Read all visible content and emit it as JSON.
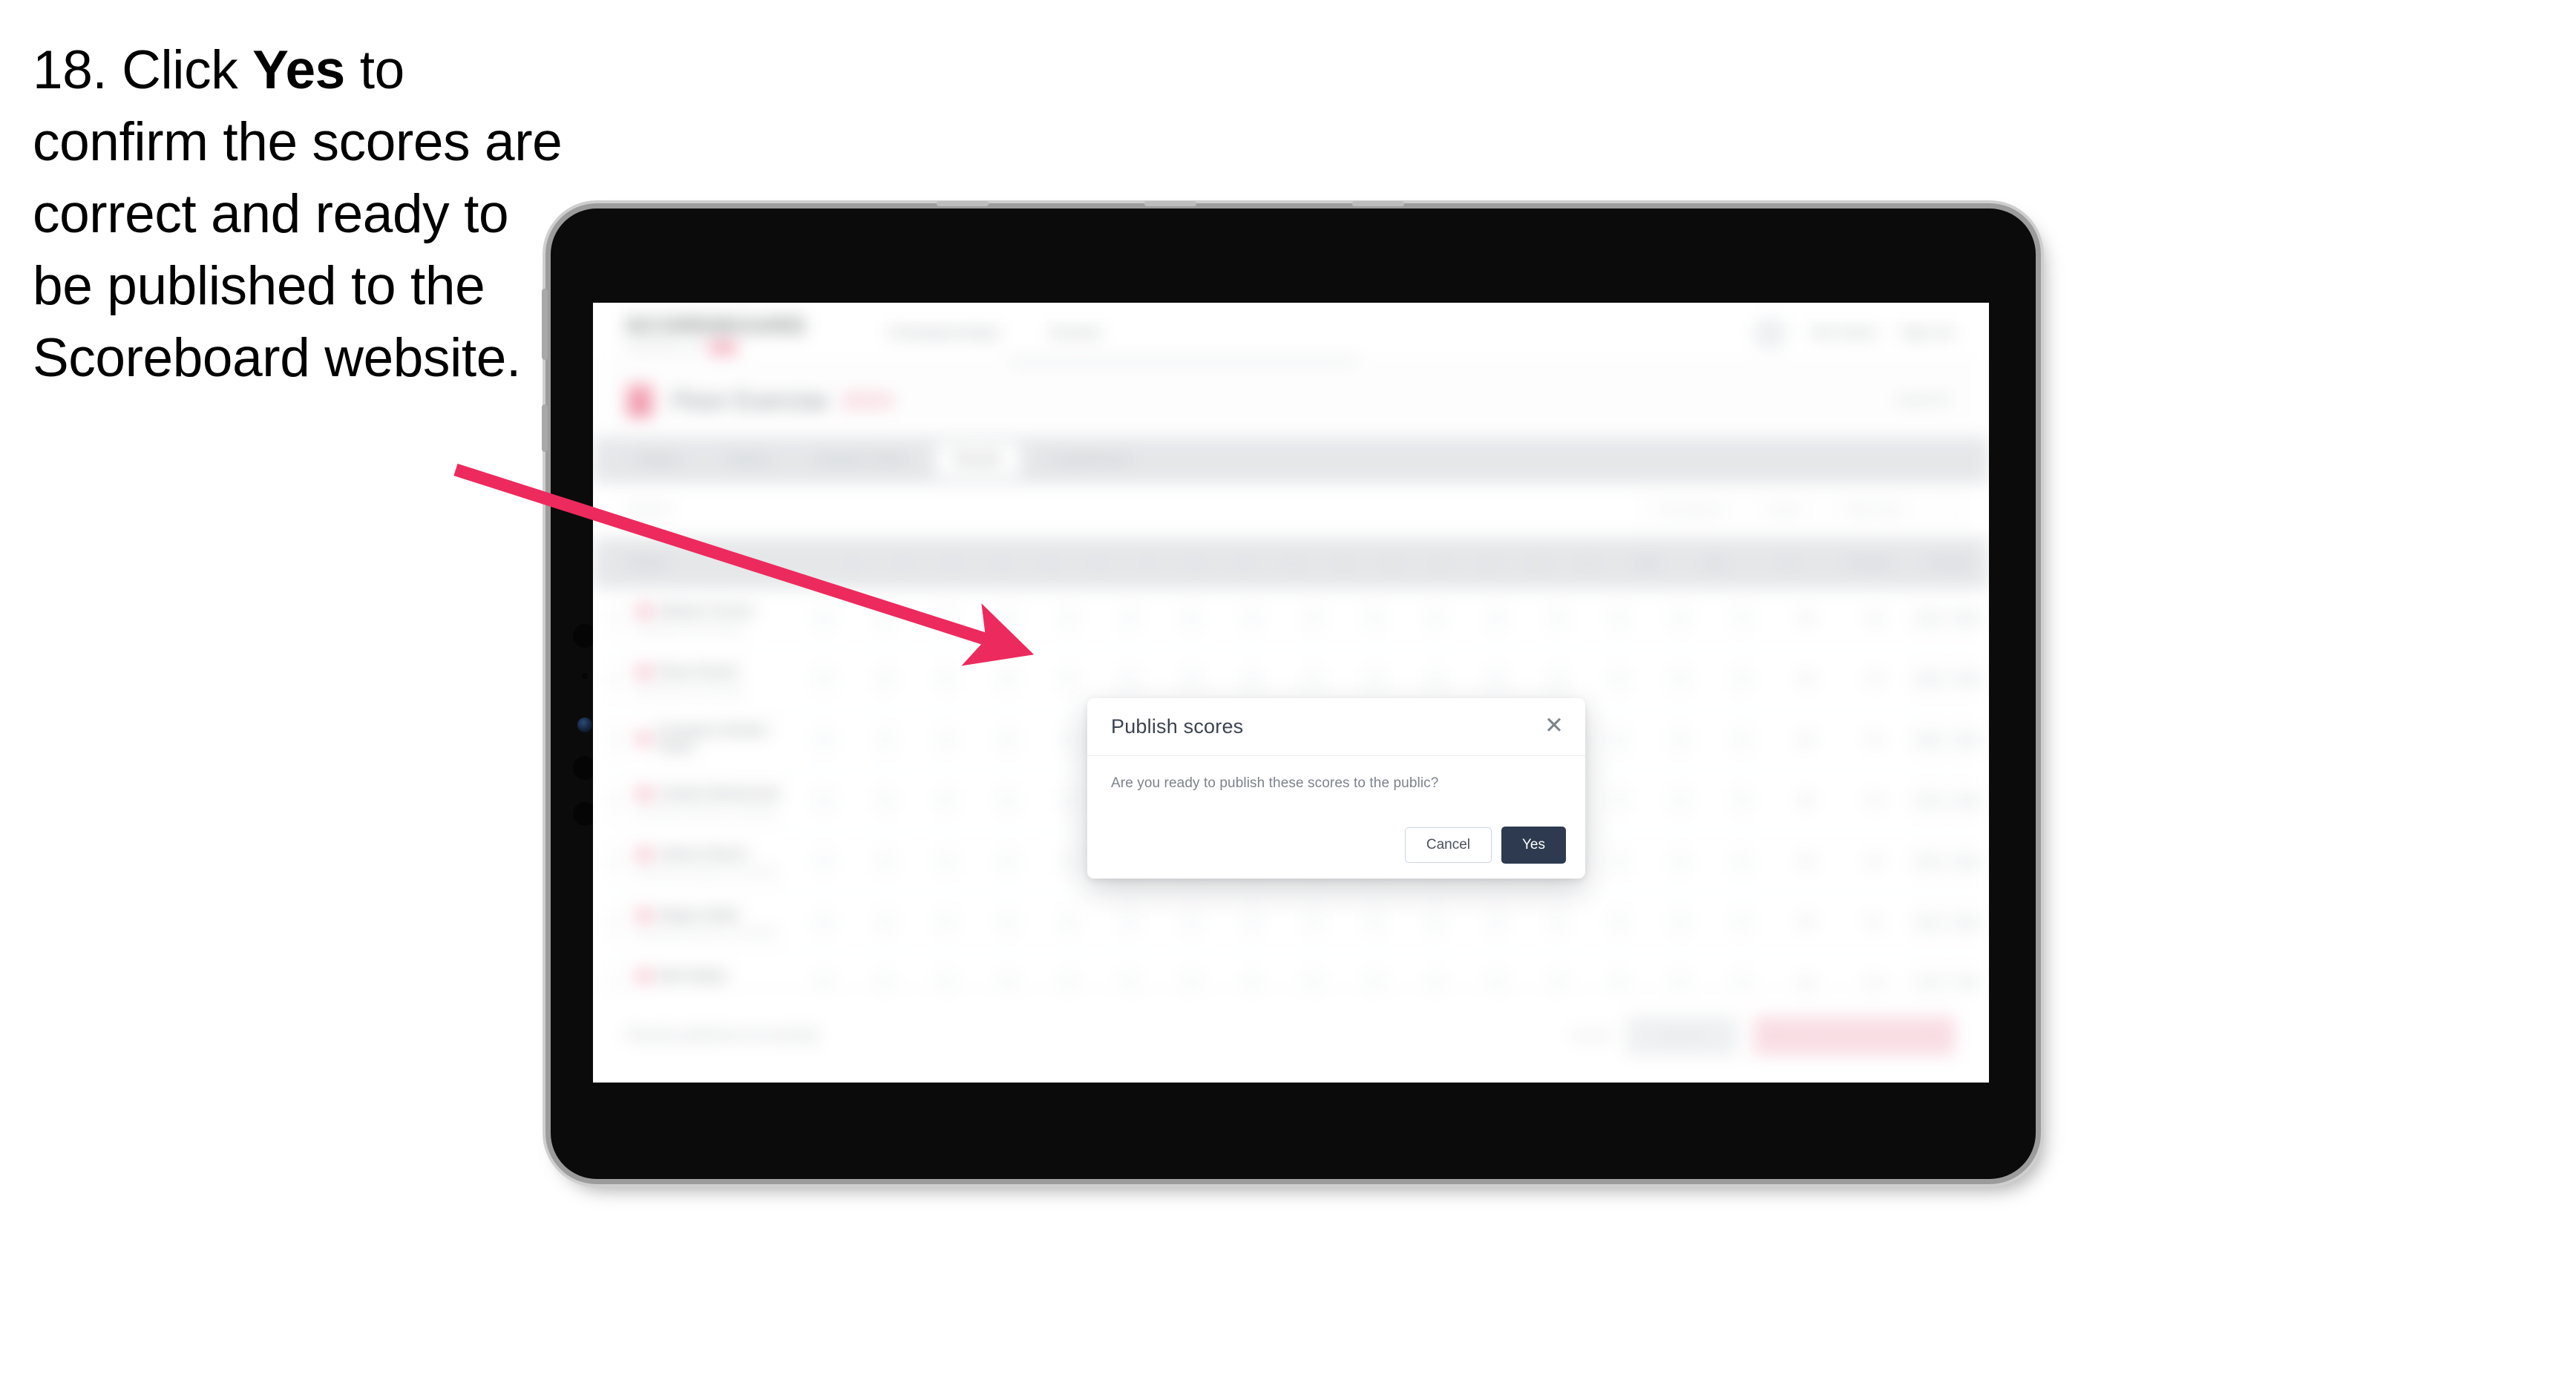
{
  "caption": {
    "prefix": "18. Click ",
    "bold": "Yes",
    "suffix": " to confirm the scores are correct and ready to be published to the Scoreboard website."
  },
  "app": {
    "brand": {
      "name": "SCOREBOARD",
      "subtitle": "POWERED BY",
      "badge": "live"
    },
    "topnav": [
      {
        "label": "Championships"
      },
      {
        "label": "Events"
      }
    ],
    "topnav_right": {
      "user": "Tom Davis",
      "signout": "Sign out",
      "avatar_icon": "avatar-icon"
    },
    "competition": {
      "title": "Floor Exercise",
      "year": "2024",
      "status": "Level 10"
    },
    "tabs": [
      {
        "label": "Judges",
        "active": false
      },
      {
        "label": "Teams",
        "active": false
      },
      {
        "label": "Session Order",
        "active": false
      },
      {
        "label": "Results",
        "active": true
      },
      {
        "label": "Leaderboard",
        "active": false
      }
    ],
    "filters": {
      "left_label": "Search",
      "chips": [
        {
          "label": "All Sessions"
        },
        {
          "label": "Senior"
        },
        {
          "label": "Rank Only"
        },
        {
          "label": "⋮"
        }
      ]
    },
    "table": {
      "headers": {
        "player": "Player",
        "numbered": [
          "1",
          "2",
          "3",
          "4",
          "5",
          "6",
          "7",
          "8",
          "9",
          "10",
          "11",
          "12",
          "13",
          "14",
          "15",
          "16"
        ],
        "wide": [
          "Total",
          "Avg"
        ],
        "right": [
          "D",
          "Penalty",
          "Position"
        ]
      },
      "rows": [
        {
          "name": "Melanie Torrens",
          "sub": "Gymnastic Club Chicago",
          "flag_icon": "flag-icon",
          "cells": [
            "9",
            "9",
            "9",
            "9",
            "9",
            "9",
            "9",
            "9",
            "9",
            "9",
            "9",
            "9",
            "9",
            "9",
            "9",
            "9"
          ],
          "total": "88",
          "avg": "9.6",
          "rank": [
            "1ST",
            "90%"
          ]
        },
        {
          "name": "Rhea Parnell",
          "sub": "Gymnastic Club Chicago",
          "flag_icon": "flag-icon",
          "cells": [
            "9",
            "9",
            "9",
            "9",
            "9",
            "9",
            "9",
            "9",
            "9",
            "9",
            "9",
            "9",
            "9",
            "9",
            "9",
            "9"
          ],
          "total": "88",
          "avg": "9.5",
          "rank": [
            "2ND",
            "88%"
          ]
        },
        {
          "name": "Constance Booker-Hayes",
          "sub": "",
          "flag_icon": "flag-icon",
          "cells": [
            "9",
            "9",
            "9",
            "9",
            "9",
            "9",
            "9",
            "9",
            "9",
            "9",
            "9",
            "9",
            "9",
            "9",
            "9",
            "9"
          ],
          "total": "88",
          "avg": "9.4",
          "rank": [
            "3RD",
            "86%"
          ]
        },
        {
          "name": "Celeste Mohammed",
          "sub": "Gymnastic Academy of Charlotte",
          "flag_icon": "flag-icon",
          "cells": [
            "9",
            "9",
            "9",
            "9",
            "9",
            "9",
            "9",
            "9",
            "9",
            "9",
            "9",
            "9",
            "9",
            "9",
            "9",
            "9"
          ],
          "total": "88",
          "avg": "9.3",
          "rank": [
            "4TH",
            "84%"
          ]
        },
        {
          "name": "Helena Okechi",
          "sub": "Gymnastic Academy of Charlotte",
          "flag_icon": "flag-icon",
          "cells": [
            "9",
            "9",
            "9",
            "9",
            "9",
            "9",
            "9",
            "9",
            "9",
            "9",
            "9",
            "9",
            "9",
            "9",
            "9",
            "9"
          ],
          "total": "88",
          "avg": "9.2",
          "rank": [
            "5TH",
            "82%"
          ]
        },
        {
          "name": "Megan Webb",
          "sub": "Gymnastic Academy of Charlotte",
          "flag_icon": "flag-icon",
          "cells": [
            "9",
            "9",
            "9",
            "9",
            "9",
            "9",
            "9",
            "9",
            "9",
            "9",
            "9",
            "9",
            "9",
            "9",
            "9",
            "9"
          ],
          "total": "88",
          "avg": "9.1",
          "rank": [
            "6TH",
            "80%"
          ]
        },
        {
          "name": "Beth Bailey",
          "sub": "Gymnastic Academy of Charlotte",
          "flag_icon": "flag-icon",
          "cells": [
            "9",
            "9",
            "9",
            "9",
            "9",
            "9",
            "9",
            "9",
            "9",
            "9",
            "9",
            "9",
            "9",
            "9",
            "9",
            "9"
          ],
          "total": "88",
          "avg": "9.0",
          "rank": [
            "7TH",
            "78%"
          ]
        }
      ]
    },
    "footer": {
      "note": "Results published successfully",
      "link": "Cancel",
      "secondary": "Save All",
      "primary": "Publish scores to public"
    }
  },
  "modal": {
    "title": "Publish scores",
    "message": "Are you ready to publish these scores to the public?",
    "cancel_label": "Cancel",
    "confirm_label": "Yes",
    "close_icon": "close-icon"
  },
  "colors": {
    "arrow": "#ED2A5D",
    "confirm_button": "#2D3A4F",
    "brand_accent": "#F05A7C"
  }
}
